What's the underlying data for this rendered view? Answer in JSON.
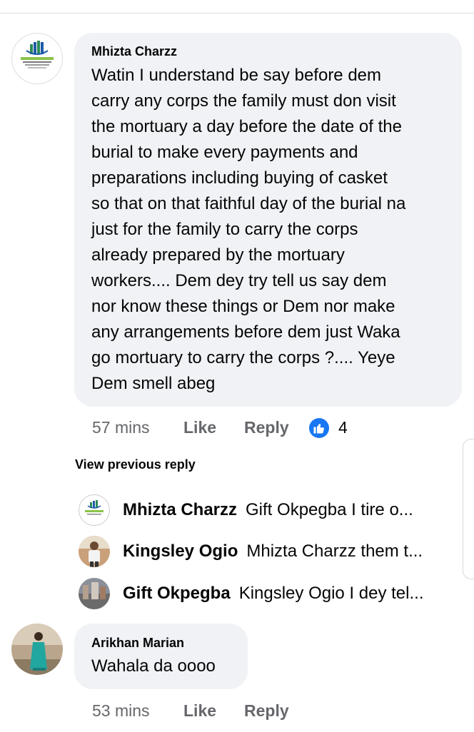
{
  "comments": [
    {
      "author": "Mhizta Charzz",
      "text": "Watin I understand be say before dem\ncarry any corps the family must don visit\nthe mortuary a day before the date of the\nburial to make every payments and\npreparations including buying of casket\nso that on that faithful day of the burial na\njust for the family to carry the corps\nalready prepared by the mortuary\nworkers.... Dem dey try tell us say dem\nnor know these things or Dem nor make\nany arrangements before dem just Waka\ngo mortuary to carry the corps ?.... Yeye\nDem smell abeg",
      "time": "57 mins",
      "like": "Like",
      "reply": "Reply",
      "reaction_count": "4",
      "reaction_icon": "thumbs-up-icon"
    },
    {
      "author": "Arikhan Marian",
      "text": "Wahala da oooo",
      "time": "53 mins",
      "like": "Like",
      "reply": "Reply"
    }
  ],
  "view_previous_reply": "View previous reply",
  "replies": [
    {
      "author": "Mhizta Charzz",
      "snippet": "Gift Okpegba I tire o..."
    },
    {
      "author": "Kingsley Ogio",
      "snippet": "Mhizta Charzz them t..."
    },
    {
      "author": "Gift Okpegba",
      "snippet": "Kingsley Ogio I dey tel..."
    }
  ],
  "colors": {
    "bubble": "#f0f2f5",
    "meta": "#65676b",
    "reaction_blue": "#1877f2"
  }
}
